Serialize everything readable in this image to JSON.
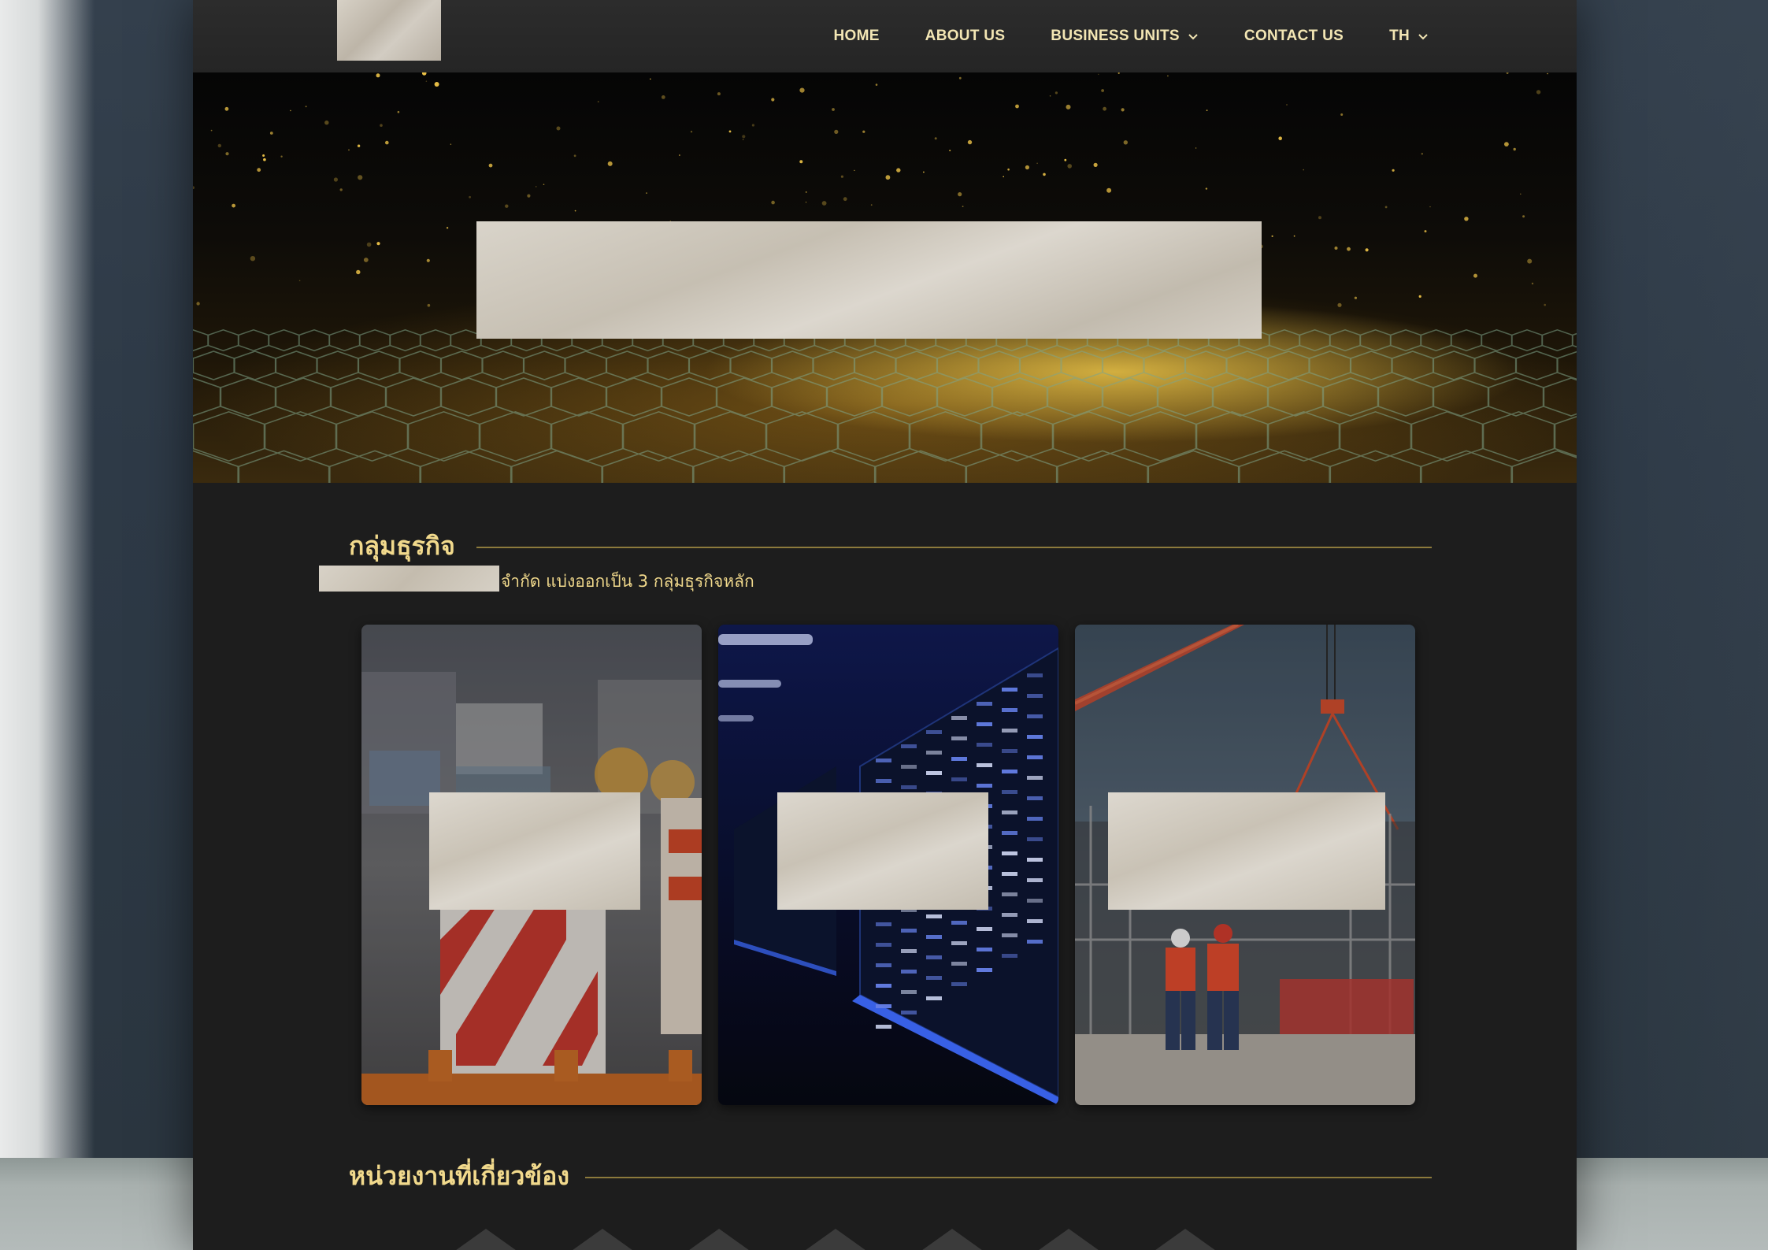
{
  "nav": {
    "items": [
      {
        "label": "HOME",
        "has_dropdown": false
      },
      {
        "label": "ABOUT US",
        "has_dropdown": false
      },
      {
        "label": "BUSINESS UNITS",
        "has_dropdown": true
      },
      {
        "label": "CONTACT US",
        "has_dropdown": false
      },
      {
        "label": "TH",
        "has_dropdown": true
      }
    ]
  },
  "business_groups": {
    "heading": "กลุ่มธุรกิจ",
    "intro": "จำกัด แบ่งออกเป็น 3 กลุ่มธุรกิจหลัก",
    "cards": [
      {
        "image": "road-construction-barrier-photo"
      },
      {
        "image": "data-center-server-rack-photo"
      },
      {
        "image": "electrical-substation-engineers-photo"
      }
    ]
  },
  "related_agencies": {
    "heading": "หน่วยงานที่เกี่ยวข้อง"
  },
  "colors": {
    "accent_gold": "#f1d98c",
    "nav_text": "#f3e6b4",
    "page_bg": "#1d1d1d"
  }
}
